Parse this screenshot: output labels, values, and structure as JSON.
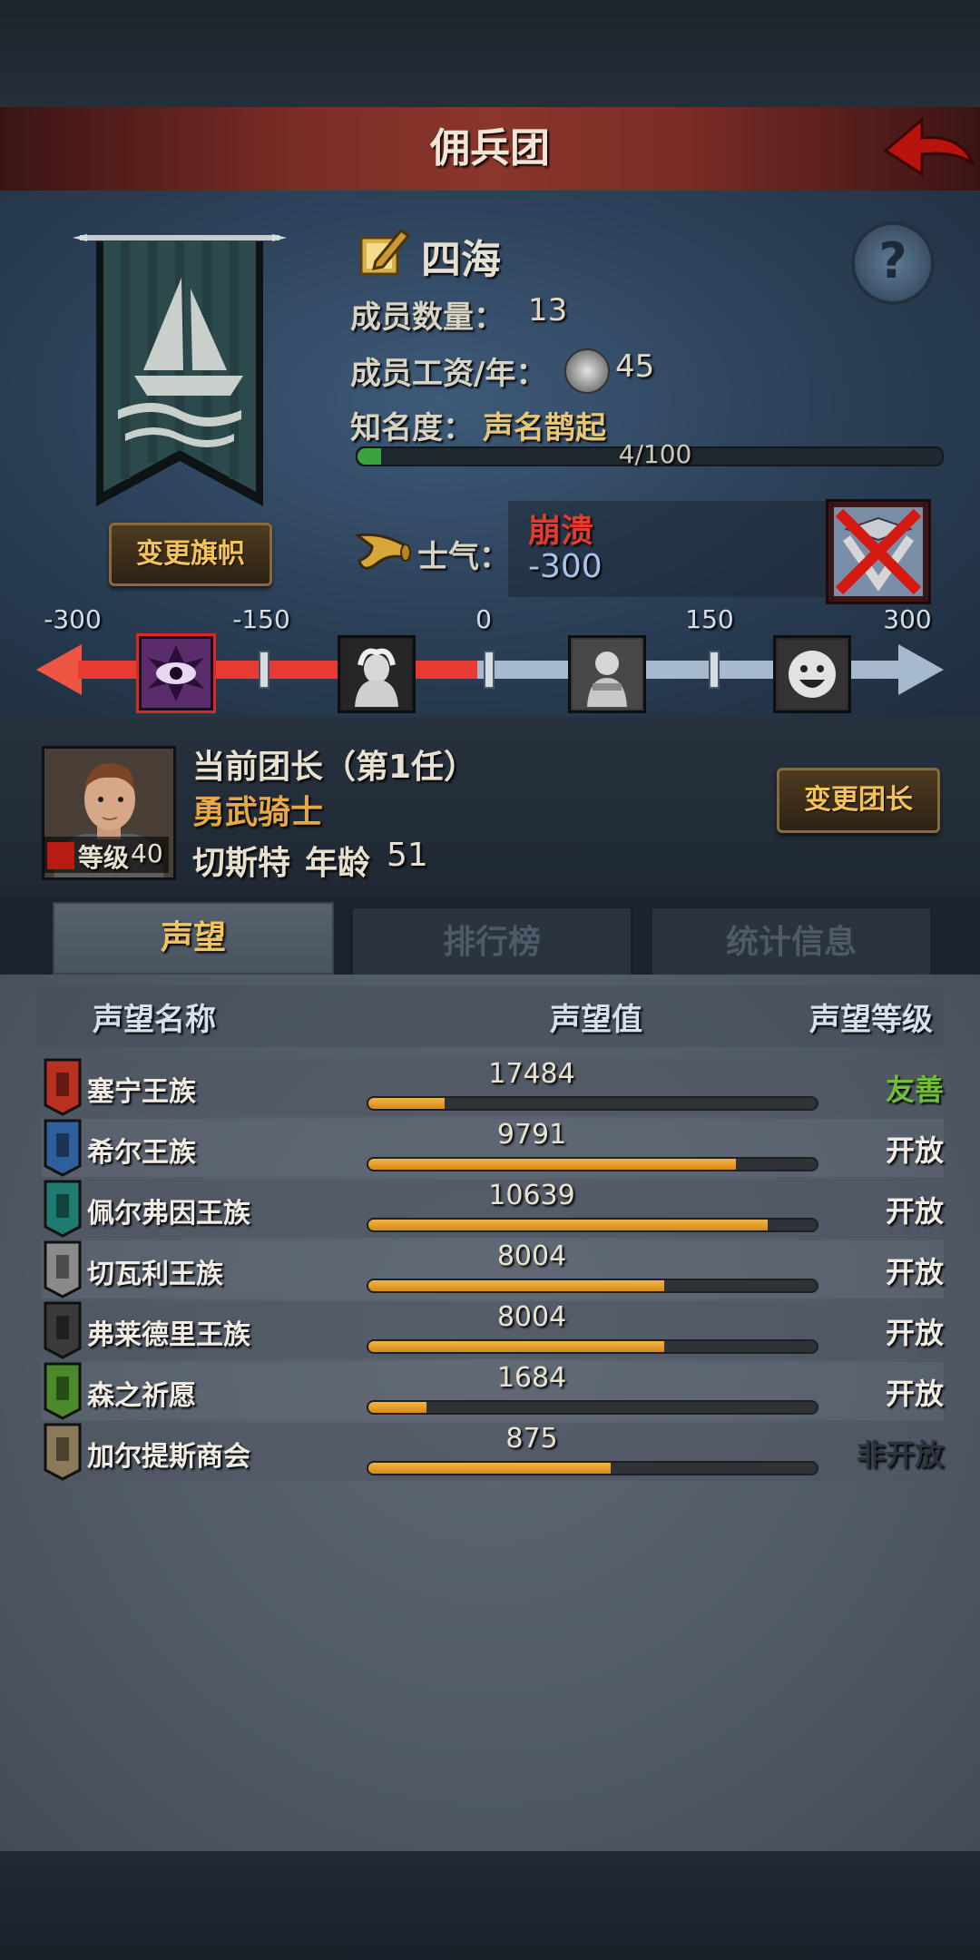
{
  "header": {
    "title": "佣兵团"
  },
  "team": {
    "name": "四海",
    "member_count_label": "成员数量：",
    "member_count": "13",
    "salary_label": "成员工资/年：",
    "salary": "45",
    "fame_label": "知名度：",
    "fame_value": "声名鹊起",
    "fame_progress": "4/100",
    "fame_fraction": 0.04,
    "change_banner_label": "变更旗帜"
  },
  "morale": {
    "label": "士气：",
    "status": "崩溃",
    "value": "-300",
    "scale_labels": [
      "-300",
      "-150",
      "0",
      "150",
      "300"
    ],
    "level_fraction": 0.0
  },
  "leader": {
    "title": "当前团长（第1任）",
    "class": "勇武骑士",
    "name": "切斯特",
    "age_label": "年龄",
    "age": "51",
    "level_label": "等级",
    "level": "40",
    "change_leader_label": "变更团长"
  },
  "tabs": [
    {
      "label": "声望",
      "active": true
    },
    {
      "label": "排行榜",
      "active": false
    },
    {
      "label": "统计信息",
      "active": false
    }
  ],
  "reputation": {
    "headers": {
      "name": "声望名称",
      "value": "声望值",
      "level": "声望等级"
    },
    "rows": [
      {
        "name": "塞宁王族",
        "value": "17484",
        "fill": 0.17,
        "level": "友善",
        "level_color": "#6fbf3a",
        "icon": "castle-banner-icon",
        "icon_color": "#b83020"
      },
      {
        "name": "希尔王族",
        "value": "9791",
        "fill": 0.82,
        "level": "开放",
        "level_color": "#f0ece4",
        "icon": "helmet-banner-icon",
        "icon_color": "#2f5f9a"
      },
      {
        "name": "佩尔弗因王族",
        "value": "10639",
        "fill": 0.89,
        "level": "开放",
        "level_color": "#f0ece4",
        "icon": "wave-banner-icon",
        "icon_color": "#1f7a72"
      },
      {
        "name": "切瓦利王族",
        "value": "8004",
        "fill": 0.66,
        "level": "开放",
        "level_color": "#f0ece4",
        "icon": "scales-banner-icon",
        "icon_color": "#8a8a8a"
      },
      {
        "name": "弗莱德里王族",
        "value": "8004",
        "fill": 0.66,
        "level": "开放",
        "level_color": "#f0ece4",
        "icon": "beast-banner-icon",
        "icon_color": "#3a3a3a"
      },
      {
        "name": "森之祈愿",
        "value": "1684",
        "fill": 0.13,
        "level": "开放",
        "level_color": "#f0ece4",
        "icon": "tree-banner-icon",
        "icon_color": "#4a8a2a"
      },
      {
        "name": "加尔提斯商会",
        "value": "875",
        "fill": 0.54,
        "level": "非开放",
        "level_color": "#2c3440",
        "icon": "chest-banner-icon",
        "icon_color": "#8a7a5a"
      }
    ]
  }
}
